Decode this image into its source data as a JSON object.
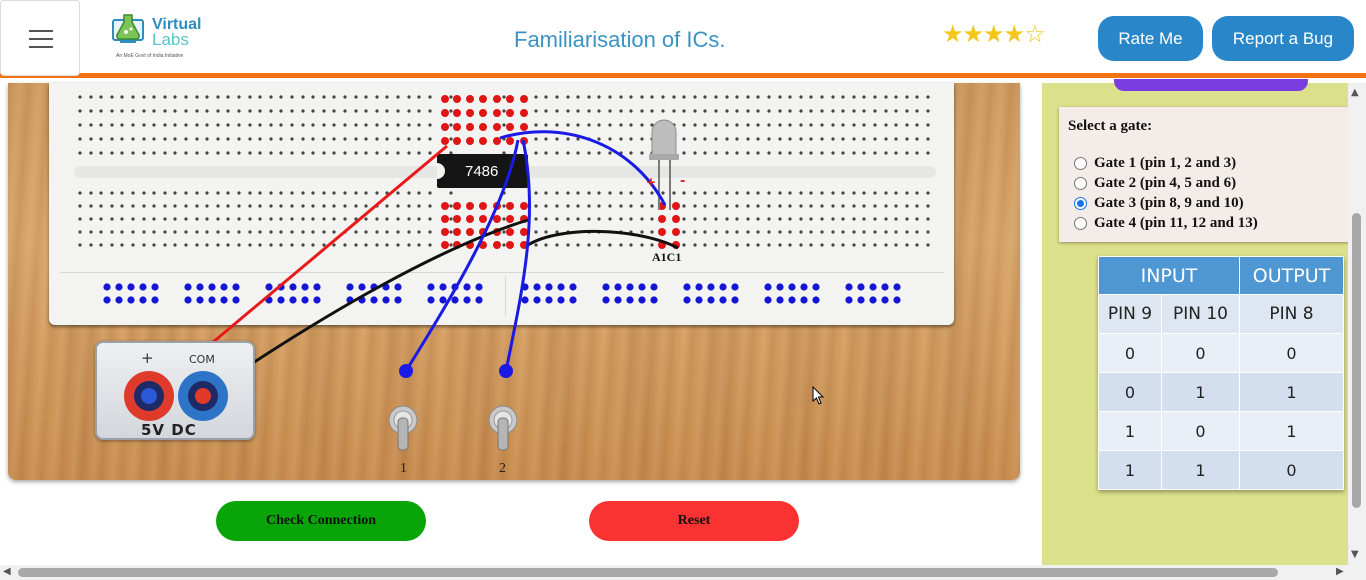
{
  "header": {
    "title": "Familiarisation of ICs.",
    "logo": {
      "word1": "Virtual",
      "word2": "Labs",
      "tagline": "An MoE Govt of India Initiative"
    },
    "rating": {
      "stars_filled": 4,
      "stars_total": 5
    },
    "rate_label": "Rate Me",
    "bug_label": "Report a Bug"
  },
  "workbench": {
    "ic_label": "7486",
    "led_label": "A1C1",
    "psu": {
      "plus": "+",
      "com": "COM",
      "label": "5V  DC"
    },
    "switches": [
      "1",
      "2"
    ],
    "colors": {
      "wire_red": "#e81a1a",
      "wire_blue": "#1a1ae6",
      "wire_black": "#111111",
      "hole_active": "#e01616",
      "rail_hole": "#1515d6"
    }
  },
  "actions": {
    "check_label": "Check Connection",
    "reset_label": "Reset"
  },
  "gate_panel": {
    "title": "Select a gate:",
    "options": [
      {
        "label": "Gate 1 (pin 1, 2 and 3)",
        "selected": false
      },
      {
        "label": "Gate 2 (pin 4, 5 and 6)",
        "selected": false
      },
      {
        "label": "Gate 3 (pin 8, 9 and 10)",
        "selected": true
      },
      {
        "label": "Gate 4 (pin 11, 12 and 13)",
        "selected": false
      }
    ]
  },
  "truth_table": {
    "group_input": "INPUT",
    "group_output": "OUTPUT",
    "columns": [
      "PIN 9",
      "PIN 10",
      "PIN 8"
    ],
    "rows": [
      [
        "0",
        "0",
        "0"
      ],
      [
        "0",
        "1",
        "1"
      ],
      [
        "1",
        "0",
        "1"
      ],
      [
        "1",
        "1",
        "0"
      ]
    ]
  }
}
